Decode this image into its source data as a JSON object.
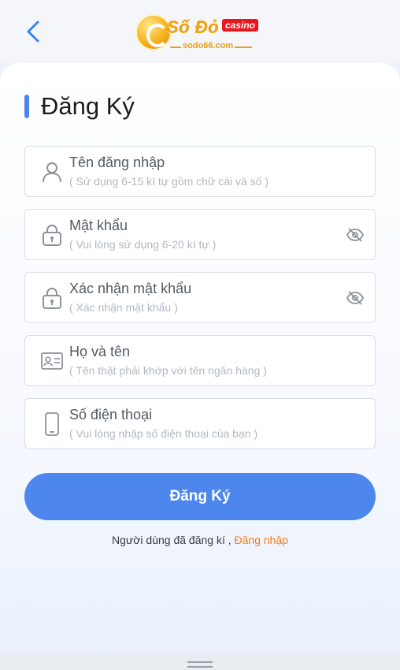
{
  "header": {
    "back_icon": "chevron-left-icon",
    "logo": {
      "brand": "Số Đỏ",
      "badge": "casino",
      "domain": "sodo66.com"
    }
  },
  "form": {
    "title": "Đăng Ký",
    "accent_color": "#4a84ee",
    "fields": [
      {
        "icon": "user-icon",
        "label": "Tên đăng nhập",
        "hint": "( Sử dụng 6-15 kí tự gồm chữ cái và số )"
      },
      {
        "icon": "lock-icon",
        "label": "Mật khẩu",
        "hint": "( Vui lòng sử dụng 6-20 kí tự )",
        "toggle_icon": "eye-off-icon"
      },
      {
        "icon": "lock-icon",
        "label": "Xác nhận mật khẩu",
        "hint": "( Xác nhận mật khẩu )",
        "toggle_icon": "eye-off-icon"
      },
      {
        "icon": "id-card-icon",
        "label": "Họ và tên",
        "hint": "( Tên thật phải khớp với tên ngân hàng )"
      },
      {
        "icon": "phone-icon",
        "label": "Số điện thoại",
        "hint": "( Vui lòng nhập số điện thoại của bạn )"
      }
    ],
    "submit_label": "Đăng Ký",
    "submit_color": "#4d87ee",
    "login_prompt": "Người dùng đã đăng kí ,",
    "login_link": "Đăng nhập",
    "link_color": "#f07d1b"
  }
}
